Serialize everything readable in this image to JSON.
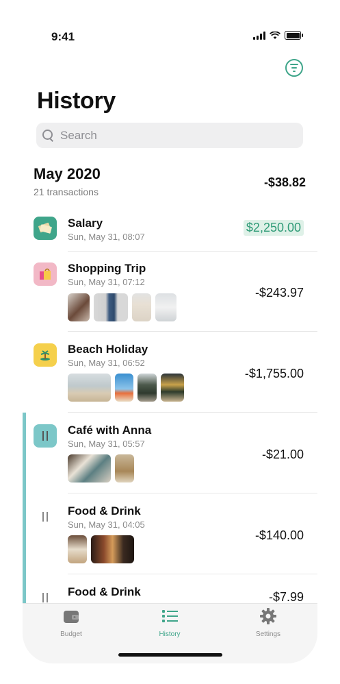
{
  "status": {
    "time": "9:41"
  },
  "header": {
    "title": "History",
    "filter_icon": "filter-icon"
  },
  "search": {
    "placeholder": "Search",
    "value": ""
  },
  "section": {
    "month": "May 2020",
    "count": "21 transactions",
    "total": "-$38.82"
  },
  "transactions": [
    {
      "name": "Salary",
      "date": "Sun, May 31, 08:07",
      "amount": "$2,250.00",
      "type": "income",
      "icon": "money-icon",
      "icon_color": "#3fa58a"
    },
    {
      "name": "Shopping Trip",
      "date": "Sun, May 31, 07:12",
      "amount": "-$243.97",
      "type": "expense",
      "icon": "shopping-bag-icon",
      "icon_color": "#f2b8c6"
    },
    {
      "name": "Beach Holiday",
      "date": "Sun, May 31, 06:52",
      "amount": "-$1,755.00",
      "type": "expense",
      "icon": "palm-tree-icon",
      "icon_color": "#f5d04c"
    },
    {
      "name": "Café with Anna",
      "date": "Sun, May 31, 05:57",
      "amount": "-$21.00",
      "type": "expense",
      "icon": "cutlery-icon",
      "icon_color": "#7cc7c8"
    },
    {
      "name": "Food & Drink",
      "date": "Sun, May 31, 04:05",
      "amount": "-$140.00",
      "type": "expense",
      "icon": "cutlery-icon",
      "icon_color": "none"
    },
    {
      "name": "Food & Drink",
      "date": "",
      "amount": "-$7.99",
      "type": "expense",
      "icon": "cutlery-icon",
      "icon_color": "none"
    }
  ],
  "tabs": [
    {
      "label": "Budget",
      "icon": "wallet-icon",
      "active": false
    },
    {
      "label": "History",
      "icon": "list-icon",
      "active": true
    },
    {
      "label": "Settings",
      "icon": "gear-icon",
      "active": false
    }
  ],
  "colors": {
    "accent": "#3fa58a",
    "active_line": "#7cc7c8"
  }
}
